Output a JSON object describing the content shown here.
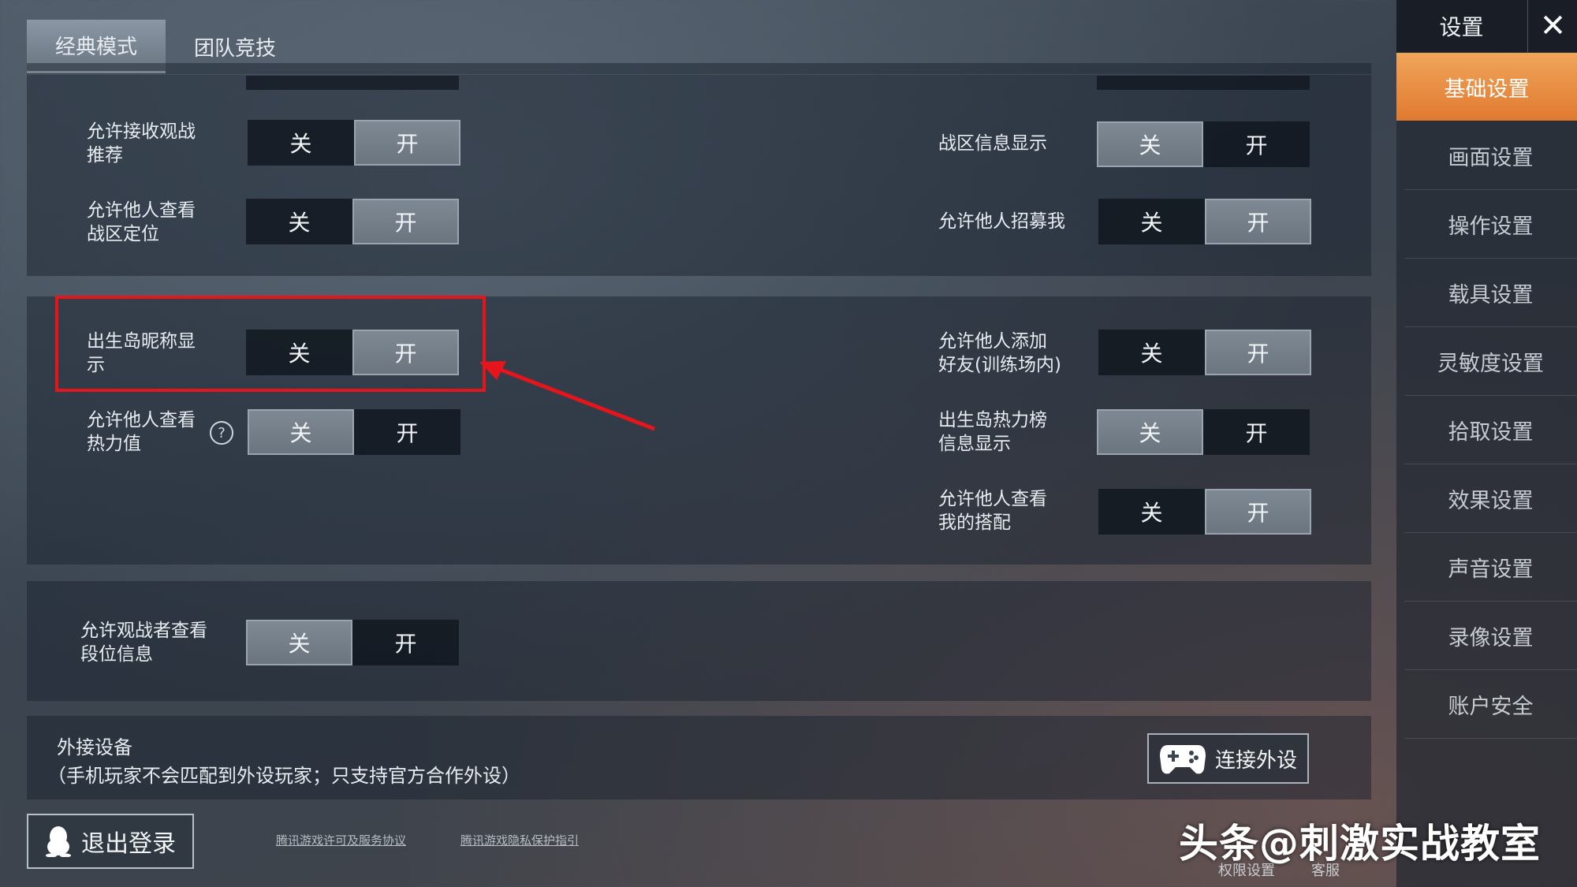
{
  "tabs": [
    {
      "label": "经典模式",
      "active": true
    },
    {
      "label": "团队竞技",
      "active": false
    }
  ],
  "toggle_labels": {
    "off": "关",
    "on": "开"
  },
  "panel1": {
    "left": [
      {
        "label": "允许接收观战推荐",
        "state": "on"
      },
      {
        "label": "允许他人查看战区定位",
        "state": "on"
      }
    ],
    "right": [
      {
        "label": "战区信息显示",
        "state": "off"
      },
      {
        "label": "允许他人招募我",
        "state": "on"
      }
    ]
  },
  "panel2": {
    "left": [
      {
        "label": "出生岛昵称显示",
        "state": "on"
      },
      {
        "label": "允许他人查看热力值",
        "state": "off",
        "help_icon": "question-circle-icon"
      }
    ],
    "right": [
      {
        "label": "允许他人添加好友(训练场内)",
        "state": "on"
      },
      {
        "label": "出生岛热力榜信息显示",
        "state": "off"
      },
      {
        "label": "允许他人查看我的搭配",
        "state": "on"
      }
    ]
  },
  "panel3": {
    "left": [
      {
        "label": "允许观战者查看段位信息",
        "state": "off"
      }
    ]
  },
  "external": {
    "title": "外接设备",
    "note": "（手机玩家不会匹配到外设玩家；只支持官方合作外设）",
    "connect_label": "连接外设",
    "connect_icon": "gamepad-icon"
  },
  "sidebar": {
    "title": "设置",
    "close_icon": "close-icon",
    "items": [
      {
        "label": "基础设置",
        "active": true
      },
      {
        "label": "画面设置"
      },
      {
        "label": "操作设置"
      },
      {
        "label": "载具设置"
      },
      {
        "label": "灵敏度设置"
      },
      {
        "label": "拾取设置"
      },
      {
        "label": "效果设置"
      },
      {
        "label": "声音设置"
      },
      {
        "label": "录像设置"
      },
      {
        "label": "账户安全"
      }
    ]
  },
  "footer": {
    "logout_label": "退出登录",
    "logout_icon": "qq-penguin-icon",
    "links": [
      "腾讯游戏许可及服务协议",
      "腾讯游戏隐私保护指引"
    ],
    "permission_label": "权限设置",
    "service_label": "客服"
  },
  "watermark": "头条@刺激实战教室",
  "colors": {
    "accent_active": "#e88a3c",
    "highlight_border": "#e4161b",
    "arrow": "#e4161b"
  }
}
